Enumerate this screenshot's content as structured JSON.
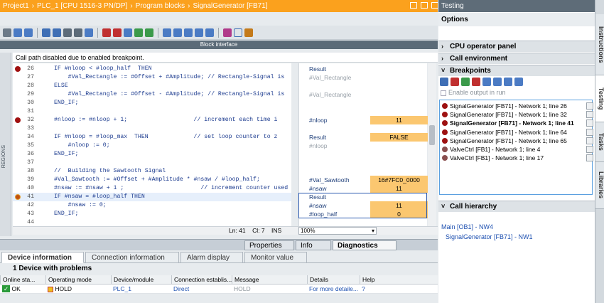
{
  "title": {
    "project": "Project1",
    "plc": "PLC_1 [CPU 1516-3 PN/DP]",
    "folder": "Program blocks",
    "block": "SignalGenerator [FB71]",
    "sep": "›"
  },
  "block_interface": "Block interface",
  "info": "Call path disabled due to enabled breakpoint.",
  "regions_label": "REGIONS",
  "code_lines": [
    {
      "n": "26",
      "t": "IF #nloop < #loop_half  THEN",
      "bp": "on"
    },
    {
      "n": "27",
      "t": "    #Val_Rectangle := #Offset + #Amplitude; // Rectangle-Signal is",
      "bp": ""
    },
    {
      "n": "28",
      "t": "ELSE",
      "bp": ""
    },
    {
      "n": "29",
      "t": "    #Val_Rectangle := #Offset - #Amplitude; // Rectangle-Signal is",
      "bp": ""
    },
    {
      "n": "30",
      "t": "END_IF;",
      "bp": ""
    },
    {
      "n": "31",
      "t": "",
      "bp": ""
    },
    {
      "n": "32",
      "t": "#nloop := #nloop + 1;                   // increment each time i",
      "bp": "on"
    },
    {
      "n": "33",
      "t": "",
      "bp": ""
    },
    {
      "n": "34",
      "t": "IF #nloop = #loop_max  THEN             // set loop counter to z",
      "bp": ""
    },
    {
      "n": "35",
      "t": "    #nloop := 0;",
      "bp": ""
    },
    {
      "n": "36",
      "t": "END_IF;",
      "bp": ""
    },
    {
      "n": "37",
      "t": "",
      "bp": ""
    },
    {
      "n": "38",
      "t": "//  Building the Sawtooth Signal",
      "bp": ""
    },
    {
      "n": "39",
      "t": "#Val_Sawtooth := #Offset + #Amplitude * #nsaw / #loop_half;",
      "bp": ""
    },
    {
      "n": "40",
      "t": "#nsaw := #nsaw + 1 ;                      // increment counter used",
      "bp": ""
    },
    {
      "n": "41",
      "t": "IF #nsaw = #loop_half THEN",
      "bp": "cur"
    },
    {
      "n": "42",
      "t": "    #nsaw := 0;",
      "bp": ""
    },
    {
      "n": "43",
      "t": "END_IF;",
      "bp": ""
    },
    {
      "n": "44",
      "t": "",
      "bp": ""
    }
  ],
  "monitor": [
    {
      "row": 0,
      "name": "Result",
      "val": "",
      "grey": false
    },
    {
      "row": 1,
      "name": "#Val_Rectangle",
      "val": "",
      "grey": true
    },
    {
      "row": 3,
      "name": "#Val_Rectangle",
      "val": "",
      "grey": true
    },
    {
      "row": 6,
      "name": "#nloop",
      "val": "11",
      "grey": false
    },
    {
      "row": 8,
      "name": "Result",
      "val": "FALSE",
      "grey": false
    },
    {
      "row": 9,
      "name": "#nloop",
      "val": "",
      "grey": true
    },
    {
      "row": 13,
      "name": "#Val_Sawtooth",
      "val": "16#7FC0_0000",
      "grey": false
    },
    {
      "row": 14,
      "name": "#nsaw",
      "val": "11",
      "grey": false
    },
    {
      "row": 15,
      "name": "Result",
      "val": "",
      "grey": false
    },
    {
      "row": 16,
      "name": "#nsaw",
      "val": "11",
      "grey": false
    },
    {
      "row": 17,
      "name": "#loop_half",
      "val": "0",
      "grey": false
    }
  ],
  "status": {
    "ln": "Ln: 41",
    "cl": "Cl: 7",
    "ins": "INS",
    "zoom": "100%"
  },
  "inspector_tabs": [
    "Properties",
    "Info",
    "Diagnostics"
  ],
  "device_tabs": [
    "Device information",
    "Connection information",
    "Alarm display",
    "Monitor value"
  ],
  "device_count": "1 Device with problems",
  "grid": {
    "headers": [
      "Online sta...",
      "Operating mode",
      "Device/module",
      "Connection establis...",
      "Message",
      "Details",
      "Help"
    ],
    "row": {
      "status": "OK",
      "mode": "HOLD",
      "device": "PLC_1",
      "conn": "Direct",
      "message": "HOLD",
      "details": "For more detaile...",
      "help": "?"
    }
  },
  "testing": {
    "title": "Testing",
    "options": "Options",
    "sections": {
      "cpu_panel": "CPU operator panel",
      "call_env": "Call environment",
      "breakpoints": "Breakpoints",
      "call_hierarchy": "Call hierarchy"
    },
    "enable_output": "Enable output in run",
    "breakpoints": [
      {
        "t": "SignalGenerator [FB71] - Network 1; line 26",
        "bold": false,
        "on": true
      },
      {
        "t": "SignalGenerator [FB71] - Network 1; line 32",
        "bold": false,
        "on": true
      },
      {
        "t": "SignalGenerator [FB71] - Network 1; line 41",
        "bold": true,
        "on": true
      },
      {
        "t": "SignalGenerator [FB71] - Network 1; line 64",
        "bold": false,
        "on": true
      },
      {
        "t": "SignalGenerator [FB71] - Network 1; line 65",
        "bold": false,
        "on": true
      },
      {
        "t": "ValveCtrl [FB1] - Network 1; line 4",
        "bold": false,
        "on": false
      },
      {
        "t": "ValveCtrl [FB1] - Network 1; line 17",
        "bold": false,
        "on": false
      }
    ],
    "call_hierarchy": [
      "Main [OB1] - NW4",
      "SignalGenerator [FB71] - NW1"
    ]
  },
  "side_tabs": [
    "Instructions",
    "Testing",
    "Tasks",
    "Libraries"
  ]
}
